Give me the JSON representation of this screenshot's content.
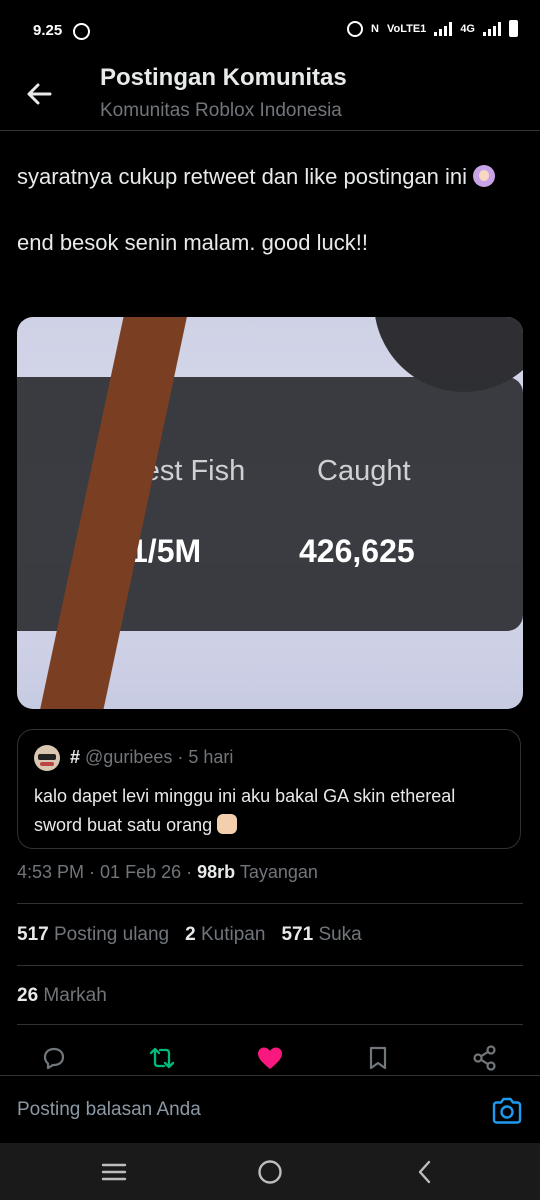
{
  "status_bar": {
    "time": "9.25",
    "network": "4G",
    "volte": "VoLTE1"
  },
  "header": {
    "title": "Postingan Komunitas",
    "subtitle": "Komunitas Roblox Indonesia"
  },
  "post": {
    "line1": "syaratnya cukup retweet dan like postingan ini",
    "line2": "end besok senin malam. good luck!!",
    "media": {
      "rarest_label": "Rarest Fish",
      "rarest_value": "1/5M",
      "caught_label": "Caught",
      "caught_value": "426,625"
    },
    "quote": {
      "name": "#",
      "handle": "@guribees",
      "time": "5 hari",
      "text": "kalo dapet levi minggu ini aku bakal GA skin ethereal sword buat satu orang"
    },
    "time": "4:53 PM",
    "date": "01 Feb 26",
    "views": "98rb",
    "views_label": "Tayangan",
    "reposts": "517",
    "reposts_label": "Posting ulang",
    "quotes": "2",
    "quotes_label": "Kutipan",
    "likes": "571",
    "likes_label": "Suka",
    "bookmarks": "26",
    "bookmarks_label": "Markah"
  },
  "actions": {
    "reply_icon": "reply-icon",
    "repost_icon": "repost-icon",
    "like_icon": "heart-icon",
    "bookmark_icon": "bookmark-icon",
    "share_icon": "share-icon",
    "repost_color": "#00ba7c",
    "like_color": "#f91880"
  },
  "reply": {
    "placeholder": "Posting balasan Anda"
  },
  "colors": {
    "accent": "#1d9bf0",
    "background": "#000000",
    "muted": "#71767b"
  }
}
